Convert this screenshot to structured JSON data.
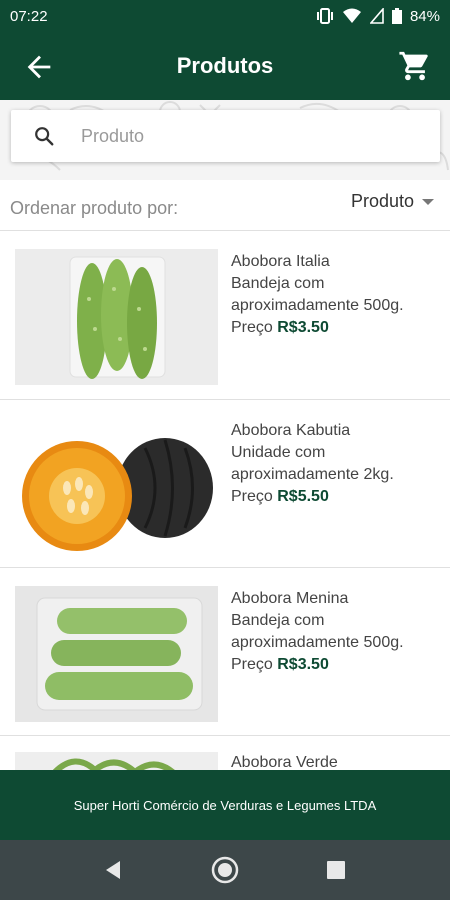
{
  "status": {
    "time": "07:22",
    "battery": "84%"
  },
  "app_bar": {
    "title": "Produtos"
  },
  "search": {
    "placeholder": "Produto",
    "value": ""
  },
  "sort": {
    "label": "Ordenar produto por:",
    "selected": "Produto"
  },
  "products": [
    {
      "name": "Abobora Italia",
      "desc_line1": "Bandeja com",
      "desc_line2": "aproximadamente 500g.",
      "price_label": "Preço",
      "price": "R$3.50"
    },
    {
      "name": "Abobora Kabutia",
      "desc_line1": "Unidade com",
      "desc_line2": "aproximadamente 2kg.",
      "price_label": "Preço",
      "price": "R$5.50"
    },
    {
      "name": "Abobora Menina",
      "desc_line1": "Bandeja com",
      "desc_line2": "aproximadamente 500g.",
      "price_label": "Preço",
      "price": "R$3.50"
    },
    {
      "name": "Abobora Verde"
    }
  ],
  "footer": {
    "text": "Super Horti Comércio de Verduras e Legumes LTDA"
  },
  "colors": {
    "primary": "#0e4a33",
    "price": "#0e4a33",
    "navbar": "#3d4749"
  },
  "icons": {
    "back": "arrow-left-icon",
    "cart": "cart-icon",
    "search": "search-icon"
  }
}
